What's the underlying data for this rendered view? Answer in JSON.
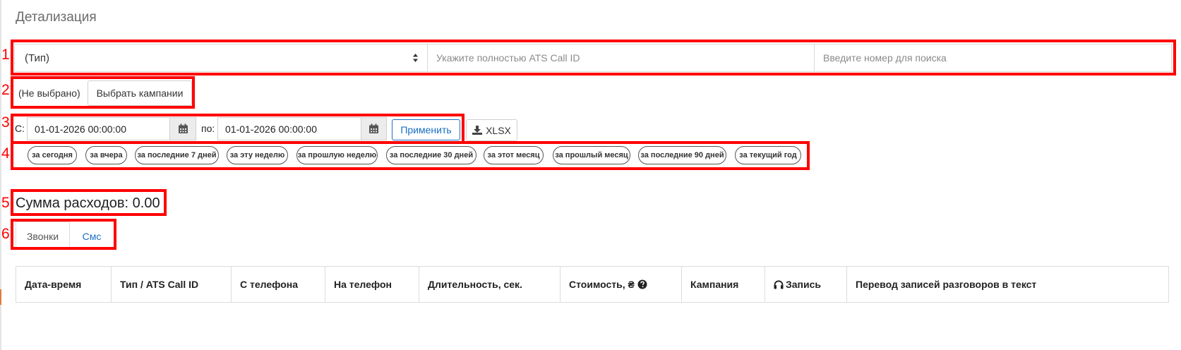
{
  "page_title": "Детализация",
  "annotations": [
    "1",
    "2",
    "3",
    "4",
    "5",
    "6"
  ],
  "filters": {
    "type_select": "(Тип)",
    "call_id_placeholder": "Укажите полностью ATS Call ID",
    "number_placeholder": "Введите номер для поиска"
  },
  "campaigns": {
    "selected": "(Не выбрано)",
    "choose_label": "Выбрать кампании"
  },
  "date_range": {
    "from_label": "С:",
    "from_value": "01-01-2026 00:00:00",
    "to_label": "по:",
    "to_value": "01-01-2026 00:00:00",
    "apply_label": "Применить",
    "export_label": "XLSX"
  },
  "quick_ranges": [
    "за сегодня",
    "за вчера",
    "за последние 7 дней",
    "за эту неделю",
    "за прошлую неделю",
    "за последние 30 дней",
    "за этот месяц",
    "за прошлый месяц",
    "за последние 90 дней",
    "за текущий год"
  ],
  "summary": {
    "label": "Сумма расходов: 0.00"
  },
  "tabs": [
    "Звонки",
    "Смс"
  ],
  "table": {
    "headers": [
      "Дата-время",
      "Тип / ATS Call ID",
      "С телефона",
      "На телефон",
      "Длительность, сек.",
      "Стоимость, ₴",
      "Кампания",
      "Запись",
      "Перевод записей разговоров в текст"
    ]
  },
  "colors": {
    "annotation": "#ff0000",
    "link": "#1a6fc4"
  }
}
